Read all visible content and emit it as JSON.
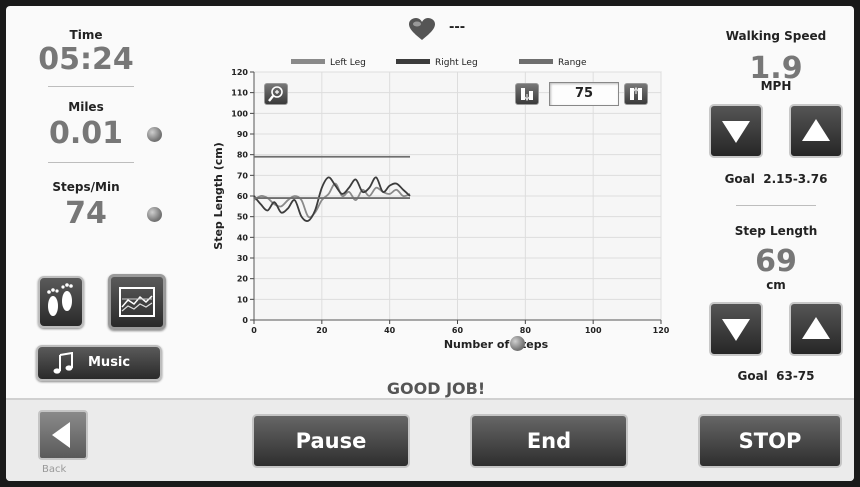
{
  "left_panel": {
    "time_label": "Time",
    "time_value": "05:24",
    "miles_label": "Miles",
    "miles_value": "0.01",
    "steps_label": "Steps/Min",
    "steps_value": "74",
    "music_label": "Music"
  },
  "heart": {
    "value": "---"
  },
  "right_panel": {
    "speed_label": "Walking Speed",
    "speed_value": "1.9",
    "speed_unit": "MPH",
    "speed_goal": "Goal  2.15-3.76",
    "step_length_label": "Step Length",
    "step_length_value": "69",
    "step_length_unit": "cm",
    "step_length_goal": "Goal  63-75"
  },
  "chart_controls": {
    "step_value": "75"
  },
  "message": "GOOD JOB!",
  "bottom_bar": {
    "back_label": "Back",
    "pause_label": "Pause",
    "end_label": "End",
    "stop_label": "STOP"
  },
  "colors": {
    "left_leg": "#8a8a8a",
    "right_leg": "#3c3c3c",
    "range": "#6e6e6e"
  },
  "chart_data": {
    "type": "line",
    "title": "",
    "xlabel": "Number of Steps",
    "ylabel": "Step Length (cm)",
    "xlim": [
      0,
      120
    ],
    "ylim": [
      0,
      120
    ],
    "x_ticks": [
      0,
      20,
      40,
      60,
      80,
      100,
      120
    ],
    "y_ticks": [
      0,
      10,
      20,
      30,
      40,
      50,
      60,
      70,
      80,
      90,
      100,
      110,
      120
    ],
    "grid": true,
    "legend_position": "top",
    "legend": [
      "Left Leg",
      "Right Leg",
      "Range"
    ],
    "series": [
      {
        "name": "Left Leg",
        "x": [
          0,
          2,
          4,
          6,
          8,
          10,
          12,
          14,
          16,
          18,
          20,
          22,
          24,
          26,
          28,
          30,
          32,
          34,
          36,
          38,
          40,
          42,
          44,
          46
        ],
        "values": [
          58,
          60,
          59,
          56,
          55,
          58,
          60,
          58,
          50,
          52,
          58,
          61,
          66,
          60,
          62,
          58,
          63,
          60,
          64,
          62,
          61,
          63,
          60,
          61
        ]
      },
      {
        "name": "Right Leg",
        "x": [
          0,
          2,
          4,
          6,
          8,
          10,
          12,
          14,
          16,
          18,
          20,
          22,
          24,
          26,
          28,
          30,
          32,
          34,
          36,
          38,
          40,
          42,
          44,
          46
        ],
        "values": [
          60,
          56,
          53,
          57,
          52,
          54,
          58,
          50,
          48,
          53,
          64,
          69,
          65,
          61,
          64,
          68,
          62,
          64,
          69,
          62,
          65,
          66,
          63,
          60
        ]
      },
      {
        "name": "Range",
        "x": [
          0,
          46
        ],
        "values": [
          79,
          79
        ]
      },
      {
        "name": "Range",
        "x": [
          0,
          46
        ],
        "values": [
          59,
          59
        ]
      }
    ]
  }
}
